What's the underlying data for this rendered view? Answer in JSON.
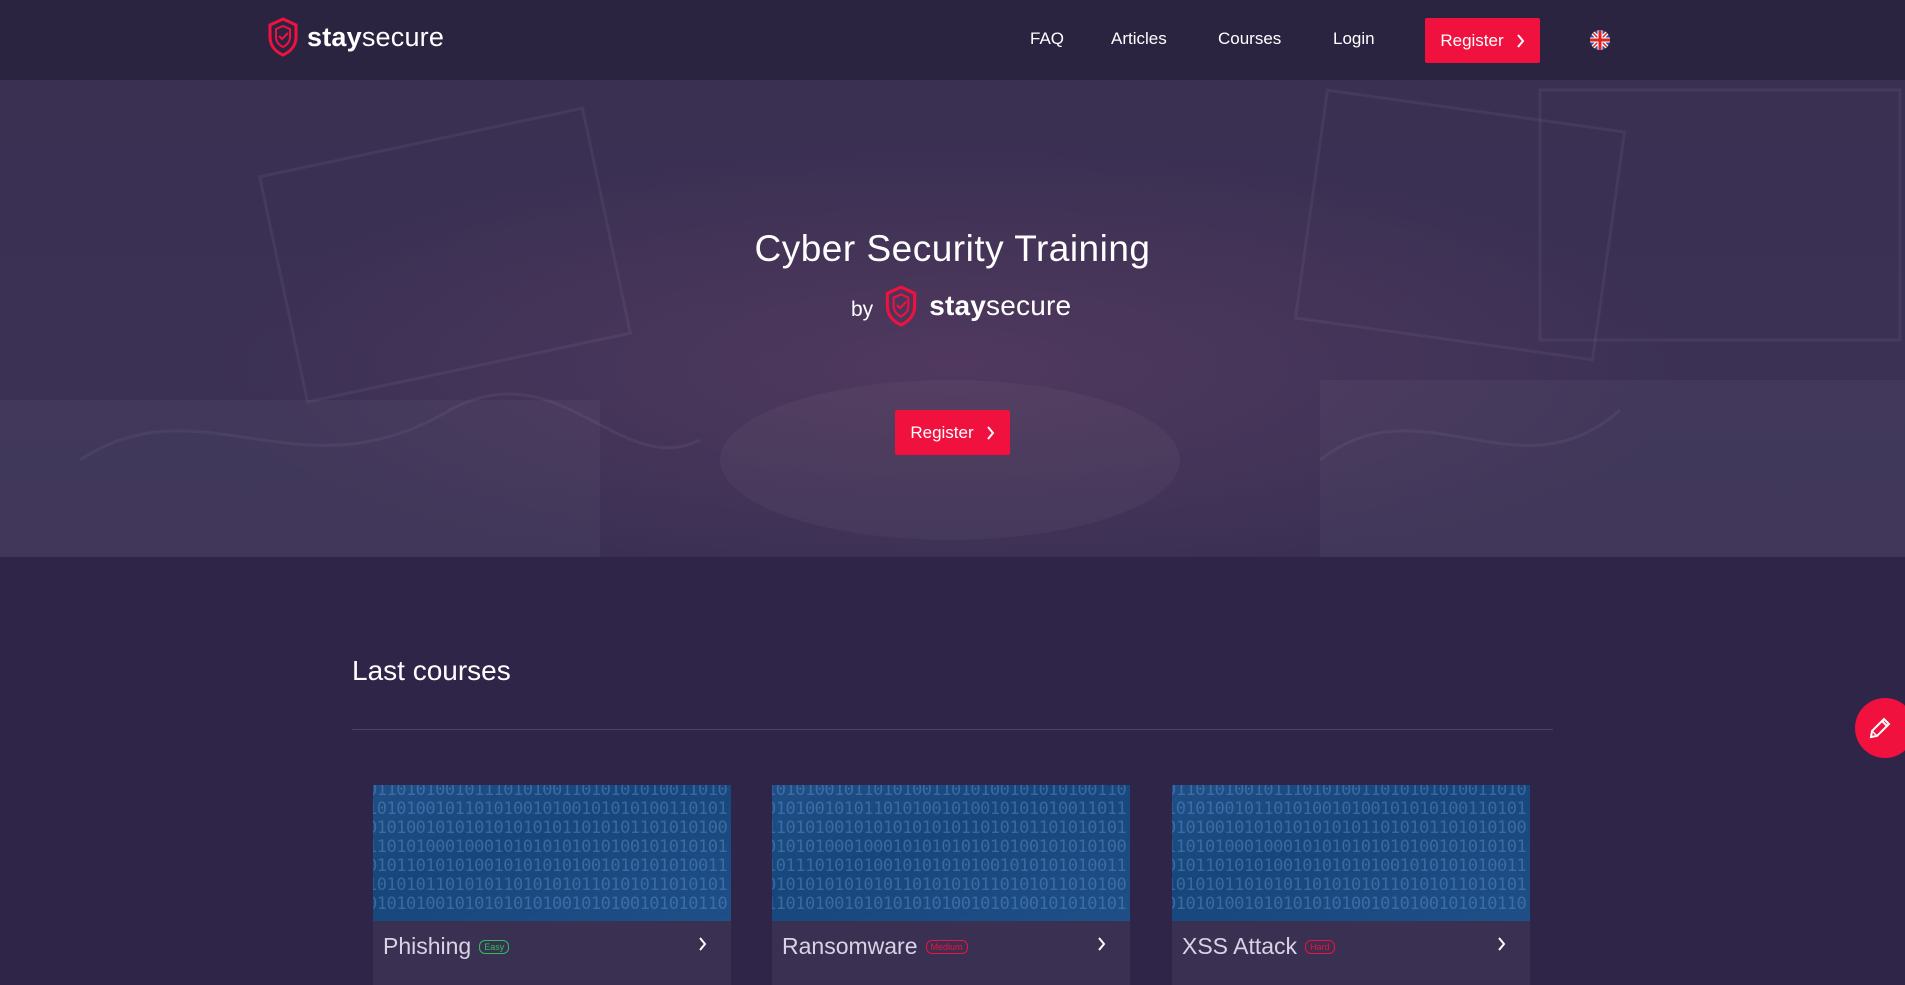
{
  "brand": {
    "bold": "stay",
    "light": "secure",
    "accent": "#f0113f"
  },
  "nav": {
    "links": [
      "FAQ",
      "Articles",
      "Courses",
      "Login"
    ],
    "register": "Register",
    "language_icon": "uk-flag-icon"
  },
  "hero": {
    "title": "Cyber Security Training",
    "by": "by",
    "register": "Register"
  },
  "courses": {
    "title": "Last courses",
    "items": [
      {
        "title": "Phishing",
        "level": "Easy",
        "level_color": "#2fbf5a"
      },
      {
        "title": "Ransomware",
        "level": "Medium",
        "level_color": "#f0113f"
      },
      {
        "title": "XSS Attack",
        "level": "Hard",
        "level_color": "#f0113f"
      }
    ]
  },
  "fab": {
    "icon": "pencil-icon"
  }
}
